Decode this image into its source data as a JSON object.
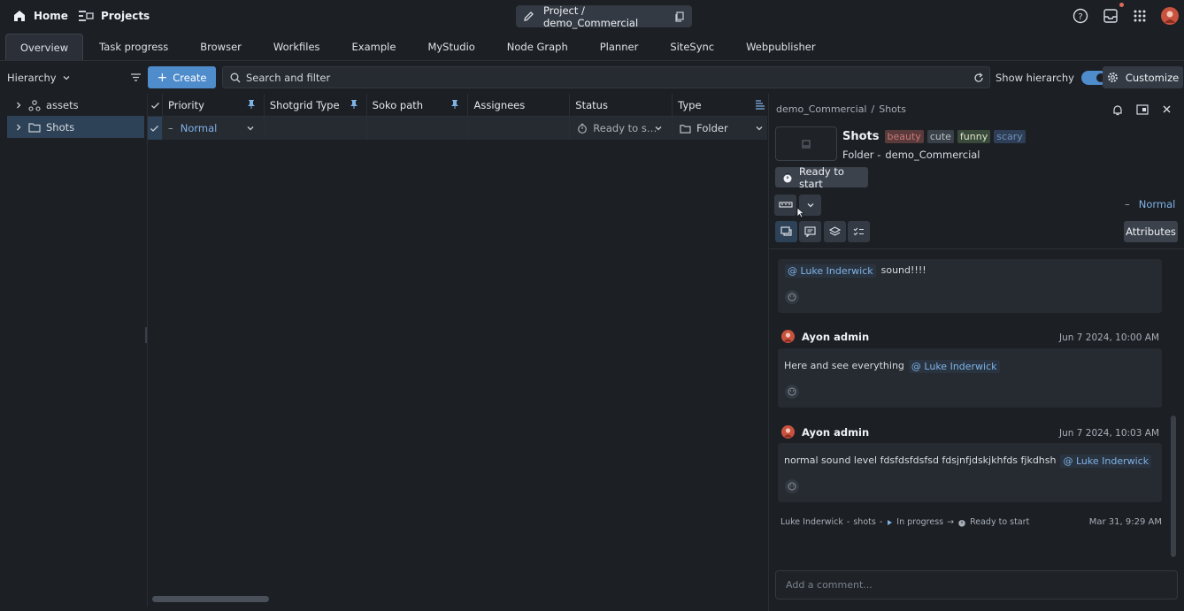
{
  "topbar": {
    "home_label": "Home",
    "projects_label": "Projects",
    "project_path": "Project / demo_Commercial"
  },
  "tabs": [
    "Overview",
    "Task progress",
    "Browser",
    "Workfiles",
    "Example",
    "MyStudio",
    "Node Graph",
    "Planner",
    "SiteSync",
    "Webpublisher"
  ],
  "toolbar": {
    "hierarchy_label": "Hierarchy",
    "create_label": "Create",
    "search_placeholder": "Search and filter",
    "show_hierarchy_label": "Show hierarchy",
    "show_hierarchy_on": true,
    "customize_label": "Customize"
  },
  "tree": [
    {
      "label": "assets",
      "icon": "asset-icon",
      "selected": false
    },
    {
      "label": "Shots",
      "icon": "folder-icon",
      "selected": true
    }
  ],
  "table": {
    "columns": [
      "Priority",
      "Shotgrid Type",
      "Soko path",
      "Assignees",
      "Status",
      "Type"
    ],
    "row": {
      "priority": "Normal",
      "priority_dash": "–",
      "shotgrid_type": "",
      "soko_path": "",
      "assignees": "",
      "status": "Ready to s…",
      "type": "Folder"
    }
  },
  "panel": {
    "breadcrumb_project": "demo_Commercial",
    "breadcrumb_sep": "/",
    "breadcrumb_entity": "Shots",
    "title": "Shots",
    "tags": [
      {
        "label": "beauty",
        "color": "#a05a5a"
      },
      {
        "label": "cute",
        "color": "#3a4048"
      },
      {
        "label": "funny",
        "color": "#3a4a3a"
      },
      {
        "label": "scary",
        "color": "#2e3e56"
      }
    ],
    "subtitle_type": "Folder -",
    "subtitle_project": "demo_Commercial",
    "status": "Ready to start",
    "priority_dash": "–",
    "priority": "Normal",
    "attributes_label": "Attributes",
    "comments": [
      {
        "author": "",
        "date": "",
        "text": "",
        "mention": "Luke Inderwick",
        "after": "sound!!!!"
      },
      {
        "author": "Ayon admin",
        "date": "Jun 7 2024, 10:00 AM",
        "text": "Here and see everything",
        "mention": "Luke Inderwick",
        "after": ""
      },
      {
        "author": "Ayon admin",
        "date": "Jun 7 2024, 10:03 AM",
        "text": "normal sound level fdsfdsfdsfsd fdsjnfjdskjkhfds fjkdhsh",
        "mention": "Luke Inderwick",
        "after": ""
      }
    ],
    "activity": {
      "user": "Luke Inderwick",
      "entity": "shots",
      "sep": "-",
      "from": "In progress",
      "to": "Ready to start",
      "date": "Mar 31, 9:29 AM"
    },
    "comment_placeholder": "Add a comment..."
  },
  "colors": {
    "accent": "#4f8ccc",
    "selection": "#2d4256",
    "mention": "#7fb2e6",
    "background": "#1c1f24"
  }
}
